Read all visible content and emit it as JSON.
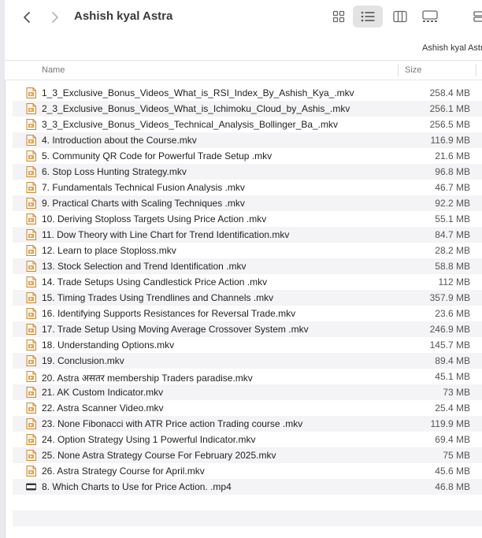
{
  "window": {
    "title": "Ashish kyal Astra",
    "path_label": "Ashish kyal Astra"
  },
  "toolbar": {
    "back_icon": "chevron-left-icon",
    "forward_icon": "chevron-right-icon",
    "views": [
      "icon-view",
      "list-view",
      "column-view",
      "gallery-view"
    ],
    "active_view": "list-view"
  },
  "columns": {
    "name": "Name",
    "size": "Size"
  },
  "files": [
    {
      "name": "1_3_Exclusive_Bonus_Videos_What_is_RSI_Index_By_Ashish_Kya_.mkv",
      "size": "258.4 MB",
      "icon": "mkv-file-icon"
    },
    {
      "name": "2_3_Exclusive_Bonus_Videos_What_is_Ichimoku_Cloud_by_Ashis_.mkv",
      "size": "256.1 MB",
      "icon": "mkv-file-icon"
    },
    {
      "name": "3_3_Exclusive_Bonus_Videos_Technical_Analysis_Bollinger_Ba_.mkv",
      "size": "256.5 MB",
      "icon": "mkv-file-icon"
    },
    {
      "name": "4.  Introduction about the Course.mkv",
      "size": "116.9 MB",
      "icon": "mkv-file-icon"
    },
    {
      "name": "5. Community QR Code for Powerful Trade Setup .mkv",
      "size": "21.6 MB",
      "icon": "mkv-file-icon"
    },
    {
      "name": "6.  Stop Loss Hunting Strategy.mkv",
      "size": "96.8 MB",
      "icon": "mkv-file-icon"
    },
    {
      "name": "7. Fundamentals   Technical Fusion Analysis .mkv",
      "size": "46.7 MB",
      "icon": "mkv-file-icon"
    },
    {
      "name": "9. Practical Charts with Scaling Techniques .mkv",
      "size": "92.2 MB",
      "icon": "mkv-file-icon"
    },
    {
      "name": "10. Deriving Stoploss Targets Using Price Action .mkv",
      "size": "55.1 MB",
      "icon": "mkv-file-icon"
    },
    {
      "name": "11. Dow Theory with Line Chart for Trend Identification.mkv",
      "size": "84.7 MB",
      "icon": "mkv-file-icon"
    },
    {
      "name": "12.  Learn to place Stoploss.mkv",
      "size": "28.2 MB",
      "icon": "mkv-file-icon"
    },
    {
      "name": "13. Stock Selection and Trend Identification .mkv",
      "size": "58.8 MB",
      "icon": "mkv-file-icon"
    },
    {
      "name": "14. Trade Setups Using Candlestick Price Action .mkv",
      "size": "112 MB",
      "icon": "mkv-file-icon"
    },
    {
      "name": "15. Timing Trades Using Trendlines and Channels .mkv",
      "size": "357.9 MB",
      "icon": "mkv-file-icon"
    },
    {
      "name": "16. Identifying Supports Resistances for Reversal Trade.mkv",
      "size": "23.6 MB",
      "icon": "mkv-file-icon"
    },
    {
      "name": "17. Trade Setup Using Moving Average Crossover System .mkv",
      "size": "246.9 MB",
      "icon": "mkv-file-icon"
    },
    {
      "name": "18.  Understanding Options.mkv",
      "size": "145.7 MB",
      "icon": "mkv-file-icon"
    },
    {
      "name": "19.  Conclusion.mkv",
      "size": "89.4 MB",
      "icon": "mkv-file-icon"
    },
    {
      "name": "20. Astra असतर membership Traders paradise.mkv",
      "size": "45.1 MB",
      "icon": "mkv-file-icon"
    },
    {
      "name": "21. AK Custom Indicator.mkv",
      "size": "73 MB",
      "icon": "mkv-file-icon"
    },
    {
      "name": "22. Astra Scanner Video.mkv",
      "size": "25.4 MB",
      "icon": "mkv-file-icon"
    },
    {
      "name": "23. None Fibonacci with ATR   Price action Trading course .mkv",
      "size": "119.9 MB",
      "icon": "mkv-file-icon"
    },
    {
      "name": "24. Option Strategy Using 1 Powerful Indicator.mkv",
      "size": "69.4 MB",
      "icon": "mkv-file-icon"
    },
    {
      "name": "25. None Astra Strategy Course For February 2025.mkv",
      "size": "75 MB",
      "icon": "mkv-file-icon"
    },
    {
      "name": "26. Astra Strategy Course for April.mkv",
      "size": "45.6 MB",
      "icon": "mkv-file-icon"
    },
    {
      "name": "8. Which Charts to Use for Price Action. .mp4",
      "size": "46.8 MB",
      "icon": "mp4-file-icon"
    }
  ]
}
